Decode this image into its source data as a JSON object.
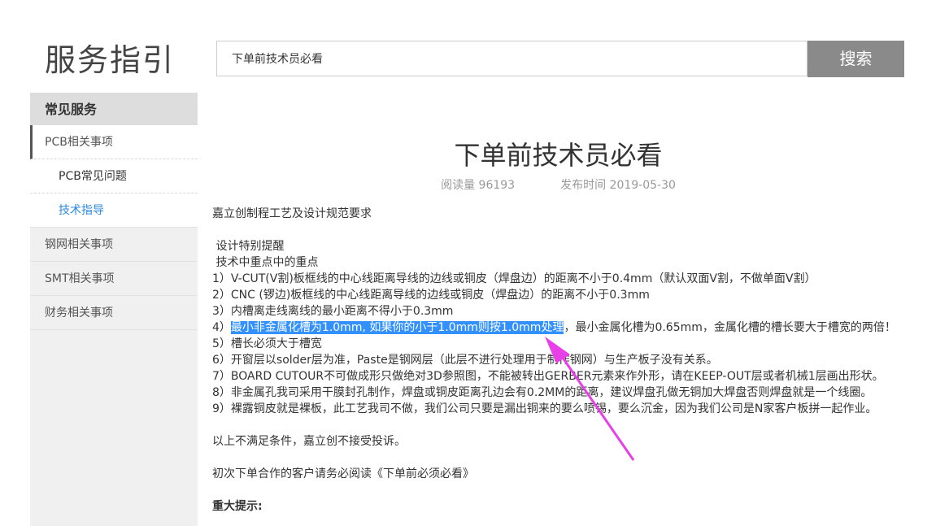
{
  "header": {
    "site_title": "服务指引",
    "search_value": "下单前技术员必看",
    "search_button": "搜索"
  },
  "sidebar": {
    "section_title": "常见服务",
    "items": [
      {
        "label": "PCB相关事项"
      },
      {
        "label": "PCB常见问题"
      },
      {
        "label": "技术指导"
      },
      {
        "label": "钢网相关事项"
      },
      {
        "label": "SMT相关事项"
      },
      {
        "label": "财务相关事项"
      }
    ]
  },
  "article": {
    "title": "下单前技术员必看",
    "read_count": "阅读量 96193",
    "publish_time": "发布时间 2019-05-30",
    "intro": "嘉立创制程工艺及设计规范要求",
    "reminder_title": " 设计特别提醒",
    "key_points_title": " 技术中重点中的重点",
    "rules": [
      "1）V-CUT(V割)板框线的中心线距离导线的边线或铜皮（焊盘边）的距离不小于0.4mm（默认双面V割，不做单面V割）",
      "2）CNC (锣边)板框线的中心线距离导线的边线或铜皮（焊盘边）的距离不小于0.3mm",
      "3）内槽离走线离线的最小距离不得小于0.3mm",
      "4）",
      "5）槽长必须大于槽宽",
      "6）开窗层以solder层为准，Paste是钢网层（此层不进行处理用于制作钢网）与生产板子没有关系。",
      "7）BOARD CUTOUR不可做成形只做绝对3D参照图，不能被转出GERBER元素来作外形，请在KEEP-OUT层或者机械1层画出形状。",
      "8）非金属孔我司采用干膜封孔制作，焊盘或铜皮距离孔边会有0.2MM的距离，建议焊盘孔做无铜加大焊盘否则焊盘就是一个线圈。",
      "9）裸露铜皮就是裸板，此工艺我司不做，我们公司只要是漏出铜来的要么喷锡，要么沉金，因为我们公司是N家客户板拼一起作业。"
    ],
    "rule4_highlight": "最小非金属化槽为1.0mm, 如果你的小于1.0mm则按1.0mm处理",
    "rule4_rest": "，最小金属化槽为0.65mm，金属化槽的槽长要大于槽宽的两倍！",
    "not_accepted": "以上不满足条件，嘉立创不接受投诉。",
    "first_order_note": "初次下单合作的客户请务必阅读《下单前必须必看》",
    "important_title": "重大提示:"
  },
  "colors": {
    "highlight": "#3391ff",
    "arrow": "#e83fe8",
    "link_active": "#2b8ae0",
    "search_button": "#8a8a8a"
  }
}
